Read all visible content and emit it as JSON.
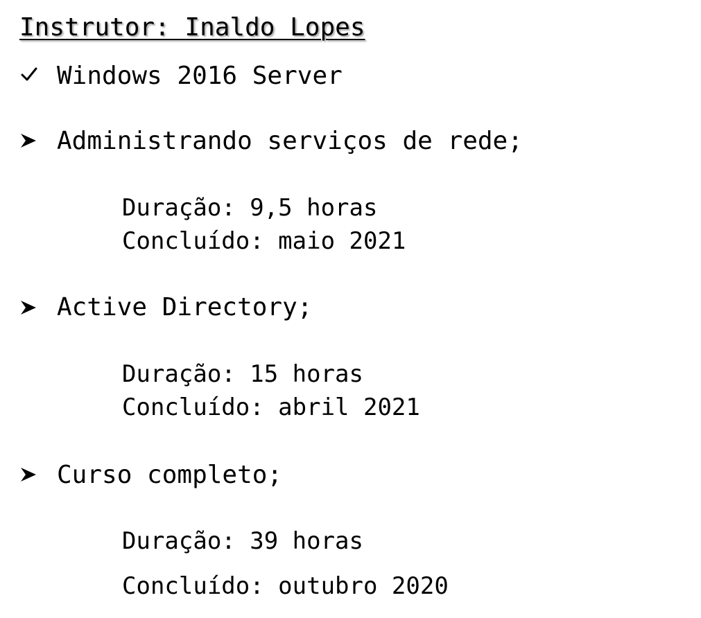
{
  "title": "Instrutor: Inaldo Lopes",
  "product": {
    "icon": "check-icon",
    "label": "Windows 2016 Server"
  },
  "courses": [
    {
      "icon": "arrow-bullet-icon",
      "name": "Administrando serviços de rede;",
      "duration": "Duração: 9,5 horas",
      "completed": "Concluído: maio 2021"
    },
    {
      "icon": "arrow-bullet-icon",
      "name": "Active Directory;",
      "duration": "Duração: 15 horas",
      "completed": "Concluído: abril 2021"
    },
    {
      "icon": "arrow-bullet-icon",
      "name": "Curso completo;",
      "duration": "Duração: 39 horas",
      "completed": "Concluído: outubro 2020"
    }
  ]
}
